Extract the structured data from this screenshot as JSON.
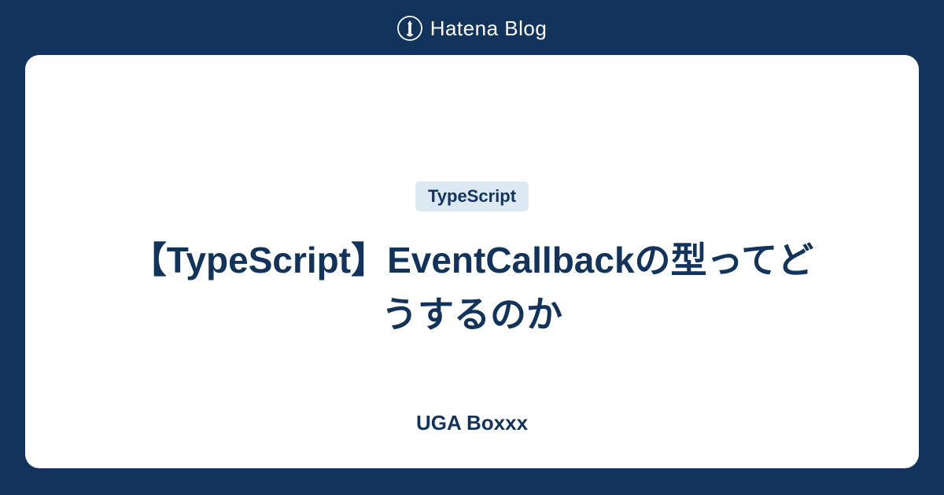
{
  "header": {
    "brand": "Hatena Blog"
  },
  "card": {
    "tag": "TypeScript",
    "title": "【TypeScript】EventCallbackの型ってどうするのか",
    "author": "UGA Boxxx"
  }
}
